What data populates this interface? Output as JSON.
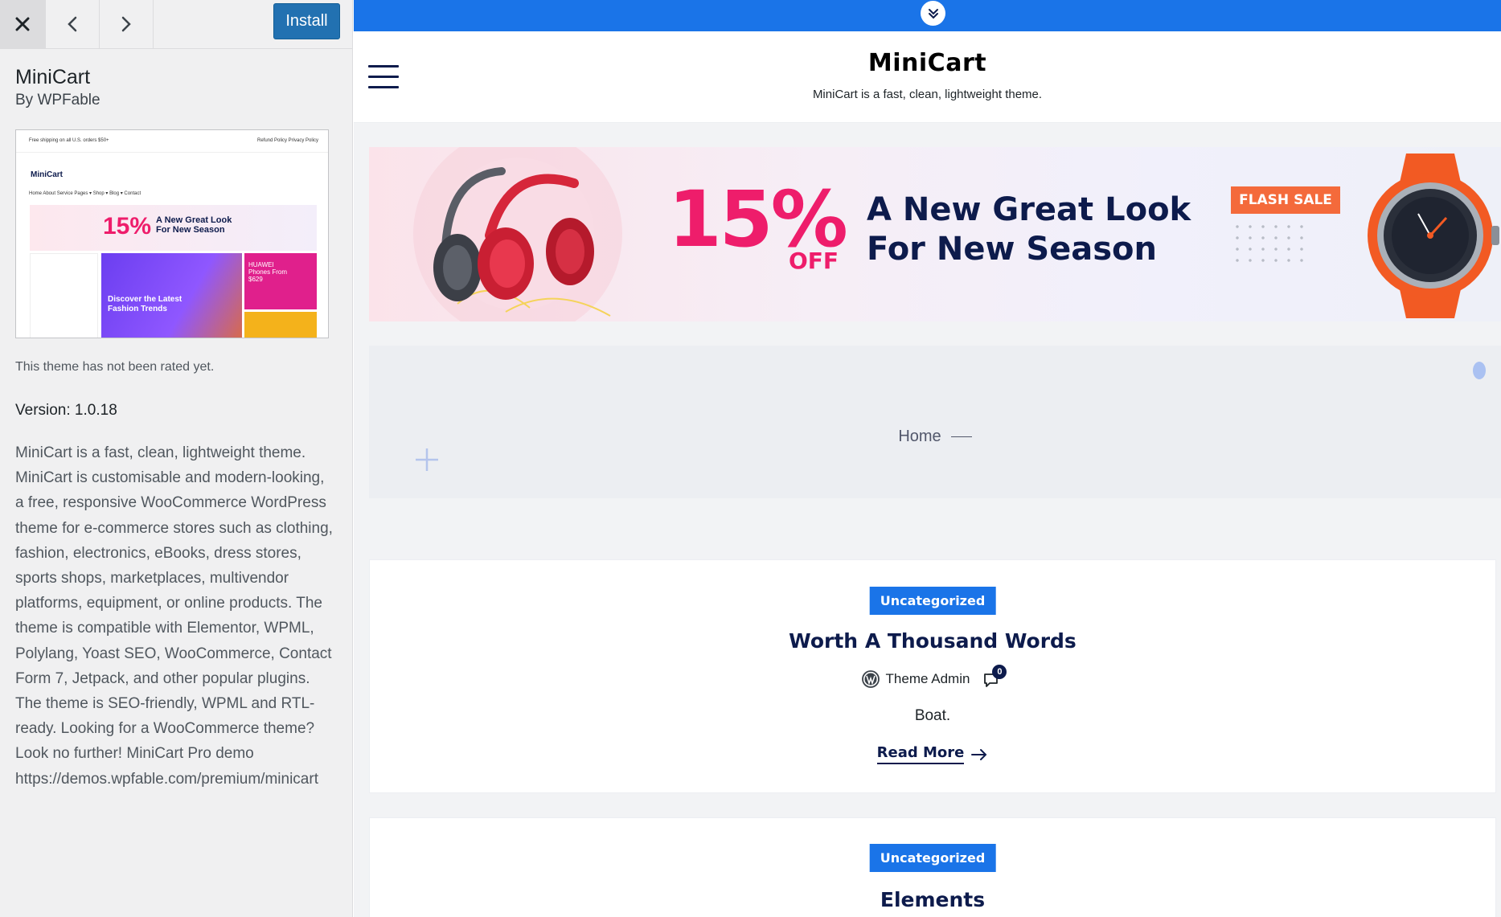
{
  "sidebar": {
    "install_label": "Install",
    "theme_name": "MiniCart",
    "theme_author": "By WPFable",
    "rating_text": "This theme has not been rated yet.",
    "version_text": "Version: 1.0.18",
    "description": "MiniCart is a fast, clean, lightweight theme. MiniCart is customisable and modern-looking, a free, responsive WooCommerce WordPress theme for e-commerce stores such as clothing, fashion, electronics, eBooks, dress stores, sports shops, marketplaces, multivendor platforms, equipment, or online products. The theme is compatible with Elementor, WPML, Polylang, Yoast SEO, WooCommerce, Contact Form 7, Jetpack, and other popular plugins. The theme is SEO-friendly, WPML and RTL-ready. Looking for a WooCommerce theme? Look no further! MiniCart Pro demo https://demos.wpfable.com/premium/minicart",
    "screenshot": {
      "topbar_left": "Free shipping on all U.S. orders $50+",
      "topbar_right": "Refund Policy   Privacy Policy",
      "logo": "MiniCart",
      "nav": "Home   About   Service   Pages ▾   Shop ▾   Blog ▾   Contact",
      "banner_pct": "15%",
      "banner_line": "A New Great Look For New Season",
      "mid_text": "Discover the Latest Fashion Trends",
      "right_text": "HUAWEI Phones From $629"
    }
  },
  "preview": {
    "site_title": "MiniCart",
    "site_tagline": "MiniCart is a fast, clean, lightweight theme.",
    "hero": {
      "percent": "15%",
      "off": "OFF",
      "line1": "A New Great Look",
      "line2": "For New Season",
      "flash": "FLASH SALE"
    },
    "breadcrumb_home": "Home",
    "posts": [
      {
        "category": "Uncategorized",
        "title": "Worth A Thousand Words",
        "author": "Theme Admin",
        "comment_count": "0",
        "excerpt": "Boat.",
        "read_more": "Read More"
      },
      {
        "category": "Uncategorized",
        "title": "Elements"
      }
    ]
  },
  "colors": {
    "accent_blue": "#1a74e8",
    "wp_blue": "#2271b1",
    "navy": "#0d1b4c",
    "pink": "#ee1d6b",
    "flash_orange": "#f46a3b"
  },
  "icons": {
    "close": "close-icon",
    "prev": "chevron-left-icon",
    "next": "chevron-right-icon",
    "collapse": "double-chevron-down-icon",
    "menu": "hamburger-menu-icon",
    "author": "wordpress-logo-icon",
    "comments": "comment-bubble-icon",
    "arrow": "arrow-right-icon"
  }
}
